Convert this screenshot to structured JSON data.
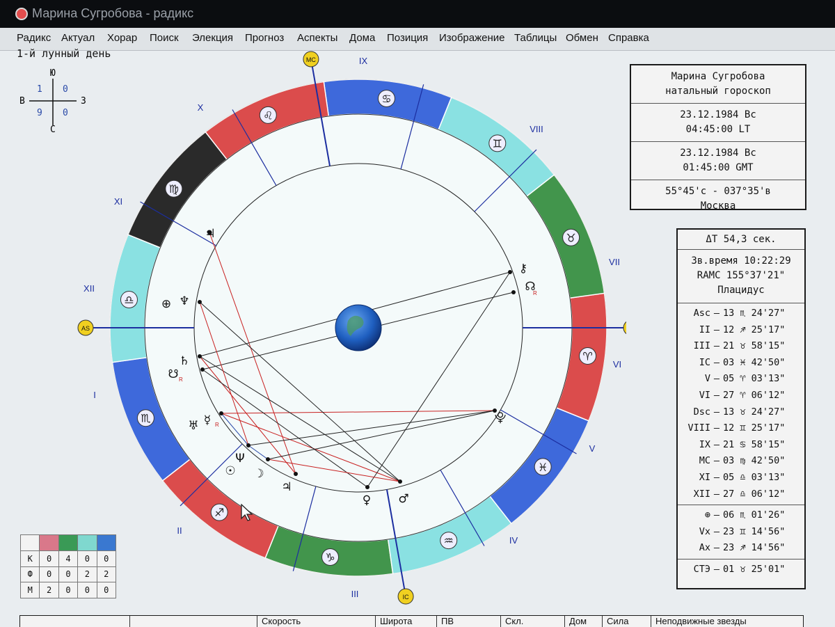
{
  "window": {
    "title": "Марина Сугробова - радикс"
  },
  "menu": [
    "Радикс",
    "Актуал",
    "Хорар",
    "Поиск",
    "Элекция",
    "Прогноз",
    "Аспекты",
    "Дома",
    "Позиция",
    "Изображение",
    "Таблицы",
    "Обмен",
    "Справка"
  ],
  "lunar_day": "1-й лунный день",
  "quadrant_widget": {
    "top": "Ю",
    "bottom": "С",
    "left": "В",
    "right": "З",
    "q_tl": "1",
    "q_tr": "0",
    "q_bl": "9",
    "q_br": "0"
  },
  "chart": {
    "house_numerals": {
      "I": "I",
      "II": "II",
      "III": "III",
      "IV": "IV",
      "V": "V",
      "VI": "VI",
      "VII": "VII",
      "VIII": "VIII",
      "IX": "IX",
      "X": "X",
      "XI": "XI",
      "XII": "XII"
    },
    "angle_badges": {
      "asc": "AS",
      "dsc": "DS",
      "mc": "MC",
      "ic": "IC"
    },
    "signs": [
      "♏",
      "♐",
      "♑",
      "♒",
      "♓",
      "♈",
      "♉",
      "♊",
      "♋",
      "♌",
      "♍",
      "♎"
    ],
    "sign_colors": {
      "fire": "#d83a3a",
      "earth": "#2f8a3a",
      "air": "#7fdfe0",
      "water": "#2a5ad8",
      "black": "#141414"
    },
    "planets": [
      "♃",
      "⊕",
      "♆",
      "♄",
      "☋",
      "♅",
      "☿",
      "Ψ",
      "☉",
      "☽",
      "♃",
      "♀",
      "♂",
      "⯓",
      "⚷",
      "☊"
    ],
    "retro_mark": "R",
    "aspect_colors": {
      "hard": "#c82020",
      "soft": "#2a4aa8",
      "neutral": "#222"
    }
  },
  "info_panel": {
    "name": "Марина Сугробова",
    "chart_type": "натальный гороскоп",
    "local_date": "23.12.1984 Вс",
    "local_time": "04:45:00 LT",
    "gmt_date": "23.12.1984 Вс",
    "gmt_time": "01:45:00 GMT",
    "coords": "55°45'с - 037°35'в",
    "city": "Москва"
  },
  "calc_panel": {
    "delta_t": "ΔT 54,3 сек.",
    "sidereal": "Зв.время 10:22:29",
    "ramc": "RAMC 155°37'21\"",
    "house_system": "Плацидус",
    "cusps": [
      {
        "name": "Asc",
        "value": "13 ♏ 24'27\""
      },
      {
        "name": "II",
        "value": "12 ♐ 25'17\""
      },
      {
        "name": "III",
        "value": "21 ♉ 58'15\""
      },
      {
        "name": "IC",
        "value": "03 ♓ 42'50\""
      },
      {
        "name": "V",
        "value": "05 ♈ 03'13\""
      },
      {
        "name": "VI",
        "value": "27 ♈ 06'12\""
      },
      {
        "name": "Dsc",
        "value": "13 ♉ 24'27\""
      },
      {
        "name": "VIII",
        "value": "12 ♊ 25'17\""
      },
      {
        "name": "IX",
        "value": "21 ♋ 58'15\""
      },
      {
        "name": "MC",
        "value": "03 ♍ 42'50\""
      },
      {
        "name": "XI",
        "value": "05 ♎ 03'13\""
      },
      {
        "name": "XII",
        "value": "27 ♎ 06'12\""
      }
    ],
    "points": [
      {
        "name": "⊕",
        "value": "06 ♏ 01'26\""
      },
      {
        "name": "Vx",
        "value": "23 ♊ 14'56\""
      },
      {
        "name": "Ax",
        "value": "23 ♐ 14'56\""
      }
    ],
    "ste": {
      "name": "СТЭ",
      "value": "01 ♉ 25'01\""
    }
  },
  "element_table": {
    "header_colors": [
      "#f3f3f3",
      "#d9788a",
      "#3a9a56",
      "#7fd8cf",
      "#3a78d0"
    ],
    "rows": [
      {
        "label": "К",
        "values": [
          "0",
          "4",
          "0",
          "0"
        ]
      },
      {
        "label": "Ф",
        "values": [
          "0",
          "0",
          "2",
          "2"
        ]
      },
      {
        "label": "М",
        "values": [
          "2",
          "0",
          "0",
          "0"
        ]
      }
    ]
  },
  "bottom_bar": [
    "",
    "",
    "Скорость",
    "Широта",
    "ПВ",
    "Скл.",
    "Дом",
    "Сила",
    "Неподвижные звезды"
  ]
}
